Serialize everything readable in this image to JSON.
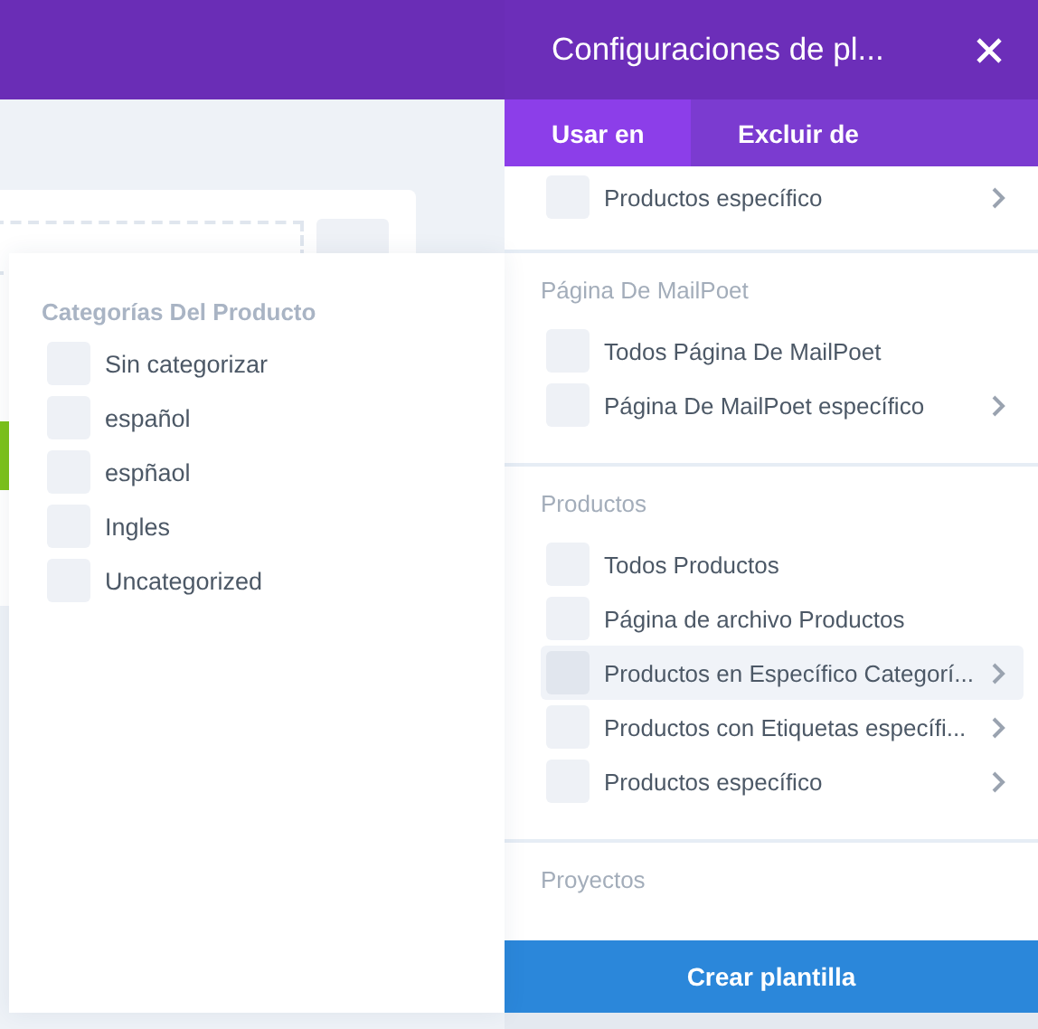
{
  "category_popup": {
    "heading": "Categorías Del Producto",
    "items": [
      {
        "label": "Sin categorizar",
        "checked": false
      },
      {
        "label": "español",
        "checked": false
      },
      {
        "label": "espñaol",
        "checked": false
      },
      {
        "label": "Ingles",
        "checked": false
      },
      {
        "label": "Uncategorized",
        "checked": false
      }
    ]
  },
  "panel": {
    "title": "Configuraciones de pl...",
    "tabs": [
      {
        "label": "Usar en",
        "selected": true
      },
      {
        "label": "Excluir de",
        "selected": false
      }
    ],
    "groups": [
      {
        "items": [
          {
            "label": "Productos específico",
            "checked": false,
            "selected": false,
            "submenu": true
          }
        ]
      },
      {
        "heading": "Página De MailPoet",
        "items": [
          {
            "label": "Todos Página De MailPoet",
            "checked": false,
            "selected": false,
            "submenu": false
          },
          {
            "label": "Página De MailPoet específico",
            "checked": false,
            "selected": false,
            "submenu": true
          }
        ]
      },
      {
        "heading": "Productos",
        "items": [
          {
            "label": "Todos Productos",
            "checked": false,
            "selected": false,
            "submenu": false
          },
          {
            "label": "Página de archivo Productos",
            "checked": false,
            "selected": false,
            "submenu": false
          },
          {
            "label": "Productos en Específico Categorí...",
            "checked": false,
            "selected": true,
            "submenu": true
          },
          {
            "label": "Productos con Etiquetas específi...",
            "checked": false,
            "selected": false,
            "submenu": true
          },
          {
            "label": "Productos específico",
            "checked": false,
            "selected": false,
            "submenu": true
          }
        ]
      },
      {
        "heading": "Proyectos"
      }
    ],
    "button": "Crear plantilla"
  }
}
